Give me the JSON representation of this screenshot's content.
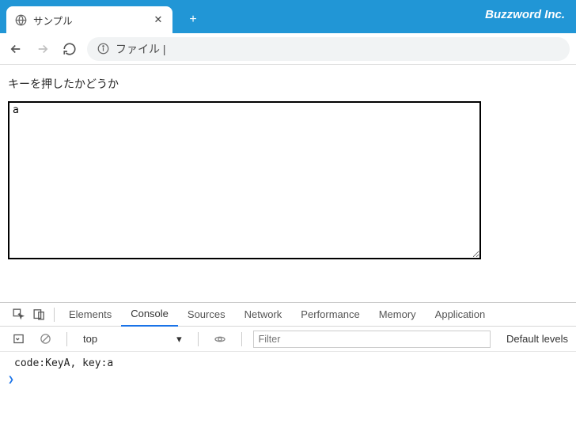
{
  "titlebar": {
    "tab_title": "サンプル",
    "brand": "Buzzword Inc."
  },
  "navbar": {
    "address_label": "ファイル |"
  },
  "page": {
    "heading": "キーを押したかどうか",
    "textarea_value": "a"
  },
  "devtools": {
    "tabs": {
      "elements": "Elements",
      "console": "Console",
      "sources": "Sources",
      "network": "Network",
      "performance": "Performance",
      "memory": "Memory",
      "application": "Application"
    },
    "toolbar": {
      "context": "top",
      "filter_placeholder": "Filter",
      "levels": "Default levels"
    },
    "console_log": "code:KeyA, key:a"
  }
}
